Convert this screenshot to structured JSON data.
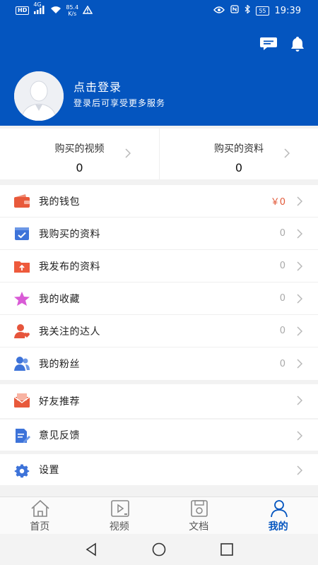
{
  "status_bar": {
    "hd_badge": "HD",
    "net_gen": "4G",
    "speed_value": "85.4",
    "speed_unit": "K/s",
    "battery": "55",
    "time": "19:39"
  },
  "profile": {
    "login_title": "点击登录",
    "login_subtitle": "登录后可享受更多服务"
  },
  "stats": [
    {
      "label": "购买的视频",
      "value": "0"
    },
    {
      "label": "购买的资料",
      "value": "0"
    }
  ],
  "menu": {
    "wallet": {
      "label": "我的钱包",
      "value": "￥0"
    },
    "purchased_docs": {
      "label": "我购买的资料",
      "value": "0"
    },
    "published_docs": {
      "label": "我发布的资料",
      "value": "0"
    },
    "favorites": {
      "label": "我的收藏",
      "value": "0"
    },
    "following": {
      "label": "我关注的达人",
      "value": "0"
    },
    "fans": {
      "label": "我的粉丝",
      "value": "0"
    },
    "recommend": {
      "label": "好友推荐"
    },
    "feedback": {
      "label": "意见反馈"
    },
    "settings": {
      "label": "设置"
    }
  },
  "tabs": [
    {
      "label": "首页",
      "icon": "home-icon"
    },
    {
      "label": "视频",
      "icon": "video-icon"
    },
    {
      "label": "文档",
      "icon": "document-icon"
    },
    {
      "label": "我的",
      "icon": "user-icon"
    }
  ],
  "colors": {
    "brand": "#0455bf",
    "money": "#e25a3a",
    "wallet_icon": "#e8593b",
    "purchased_icon": "#3d73d9",
    "published_icon": "#ee5a3c",
    "favorite_icon": "#d95bd6",
    "following_icon": "#e6553c",
    "fans_icon": "#3d73d9"
  }
}
